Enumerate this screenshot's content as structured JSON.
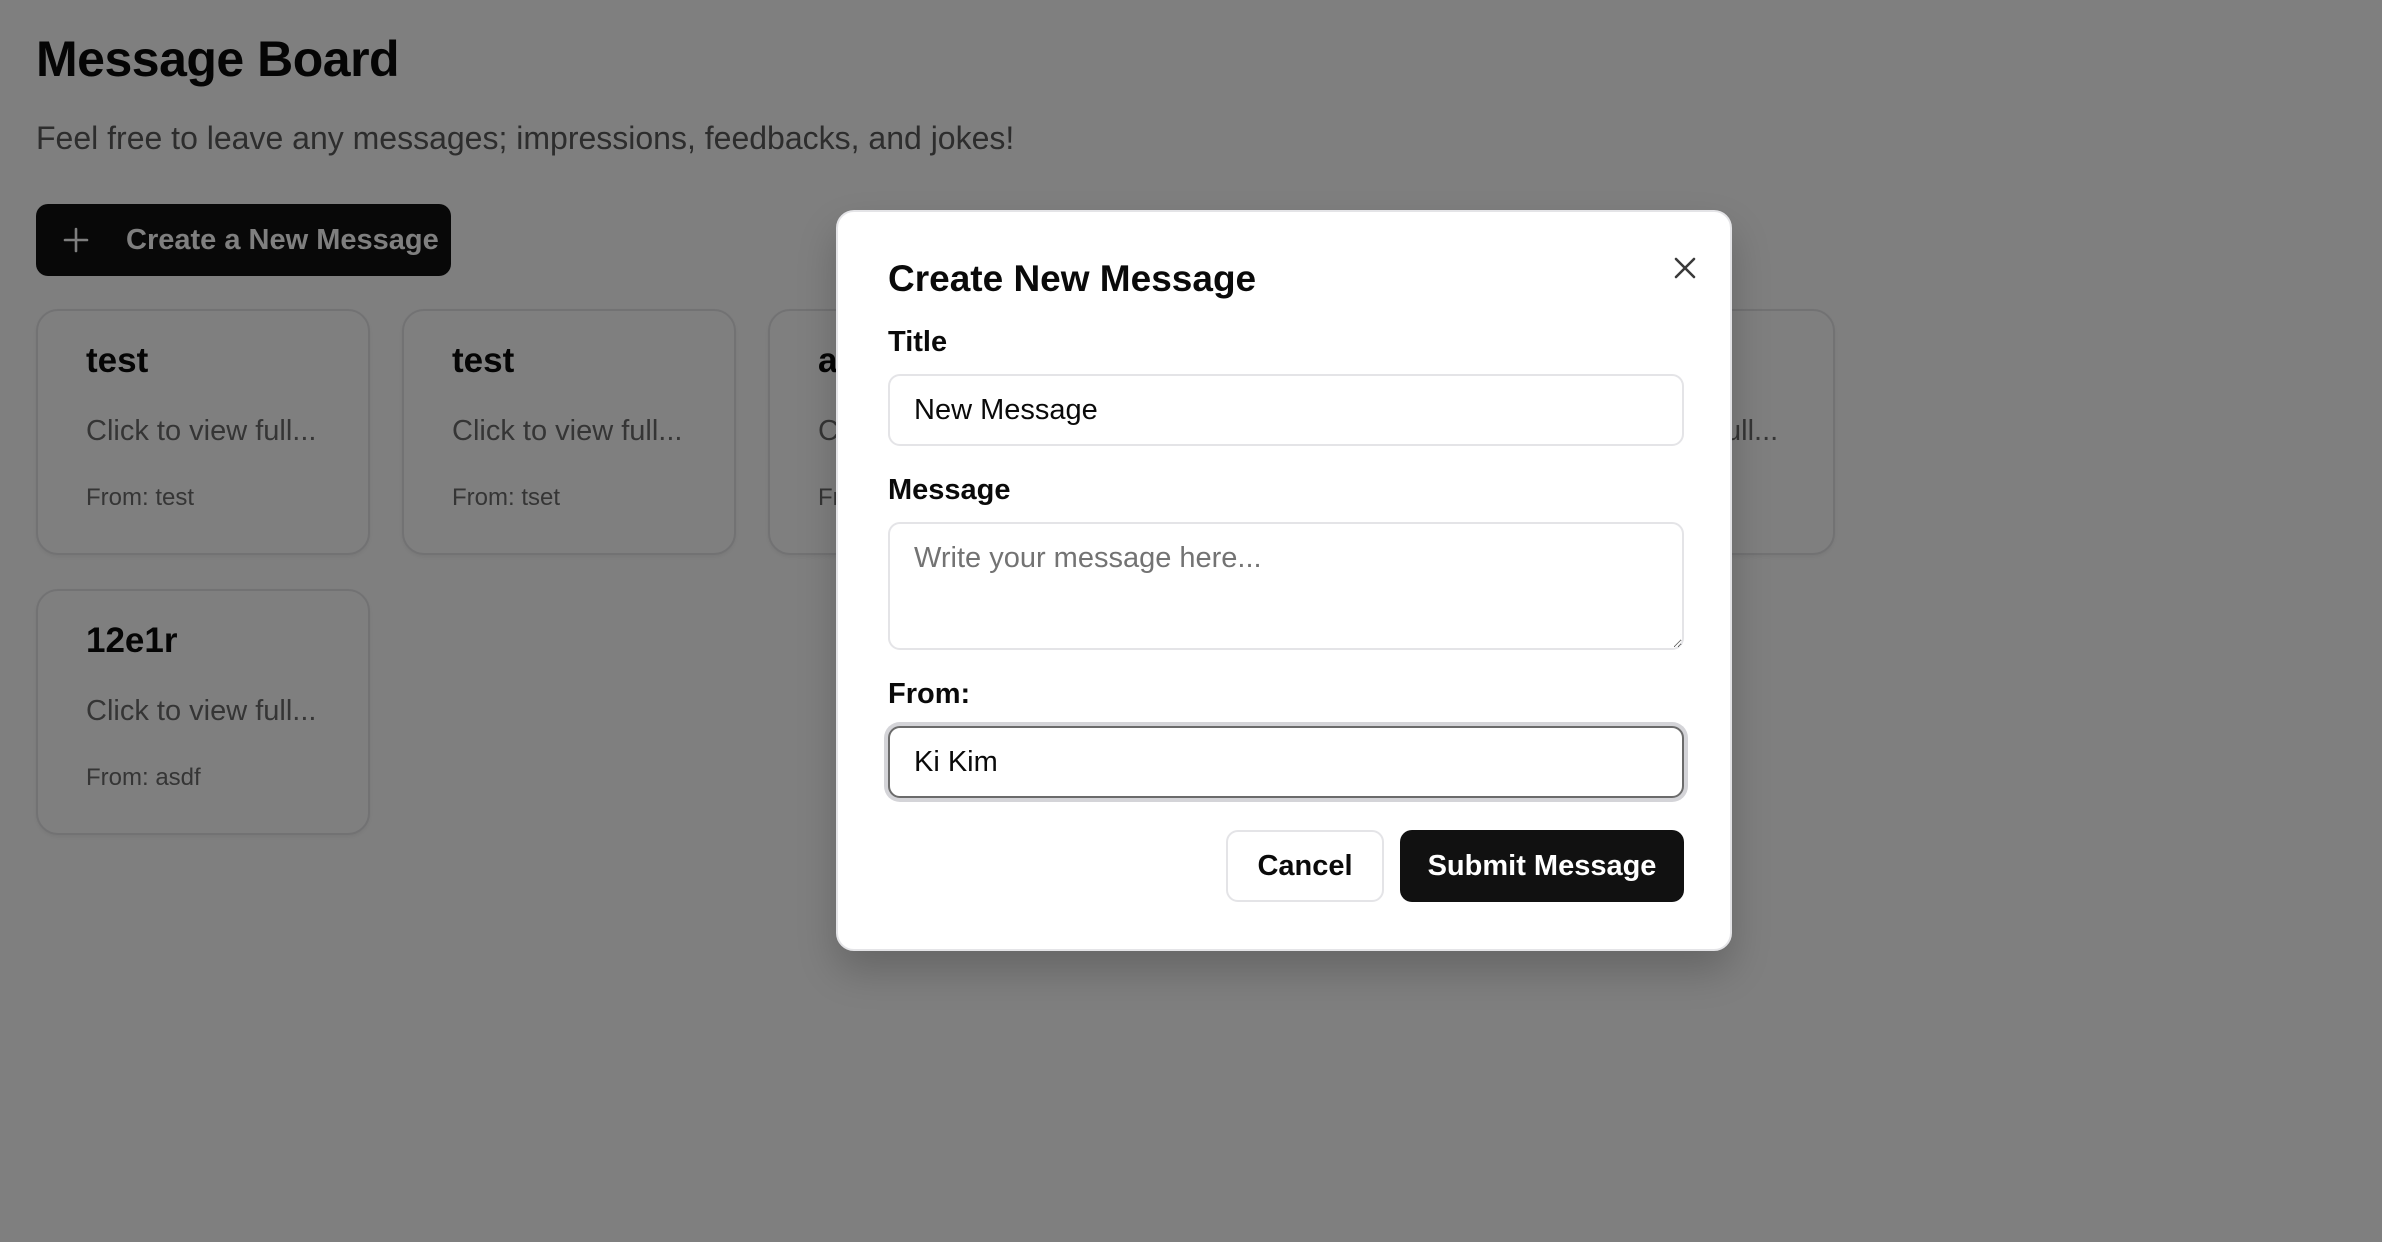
{
  "board": {
    "title": "Message Board",
    "subtitle": "Feel free to leave any messages; impressions, feedbacks, and jokes!",
    "create_button_label": "Create a New Message"
  },
  "cards": [
    {
      "title": "test",
      "preview": "Click to view full...",
      "from": "From: test"
    },
    {
      "title": "test",
      "preview": "Click to view full...",
      "from": "From: tset"
    },
    {
      "title": "a",
      "preview": "C",
      "from": "Fr"
    },
    {
      "title": "",
      "preview": "ull...",
      "from": ""
    },
    {
      "title": "12e1r",
      "preview": "Click to view full...",
      "from": "From: asdf"
    }
  ],
  "modal": {
    "title": "Create New Message",
    "title_label": "Title",
    "title_value": "New Message",
    "message_label": "Message",
    "message_placeholder": "Write your message here...",
    "from_label": "From:",
    "from_value": "Ki Kim",
    "cancel_label": "Cancel",
    "submit_label": "Submit Message"
  },
  "icons": {
    "create": "plus-icon",
    "close": "close-icon"
  },
  "colors": {
    "primary": "#111111",
    "overlay": "rgba(0,0,0,0.5)",
    "border": "#e4e4e7",
    "muted_text": "#6b6b6b"
  }
}
